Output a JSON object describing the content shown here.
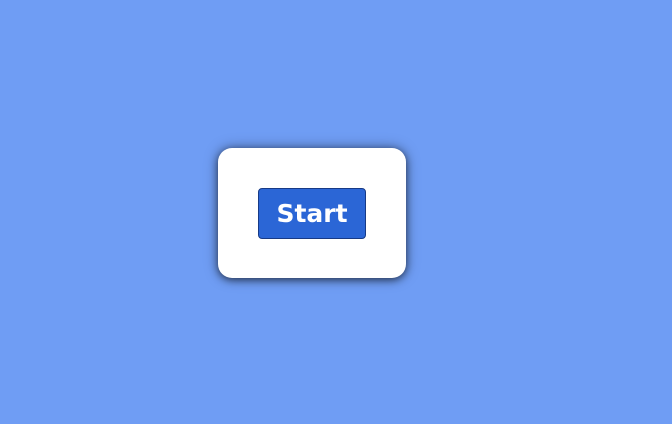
{
  "dialog": {
    "start_button_label": "Start"
  },
  "colors": {
    "background": "#6f9df4",
    "card": "#ffffff",
    "button": "#2b66d6",
    "button_border": "#173a86",
    "button_text": "#ffffff"
  }
}
